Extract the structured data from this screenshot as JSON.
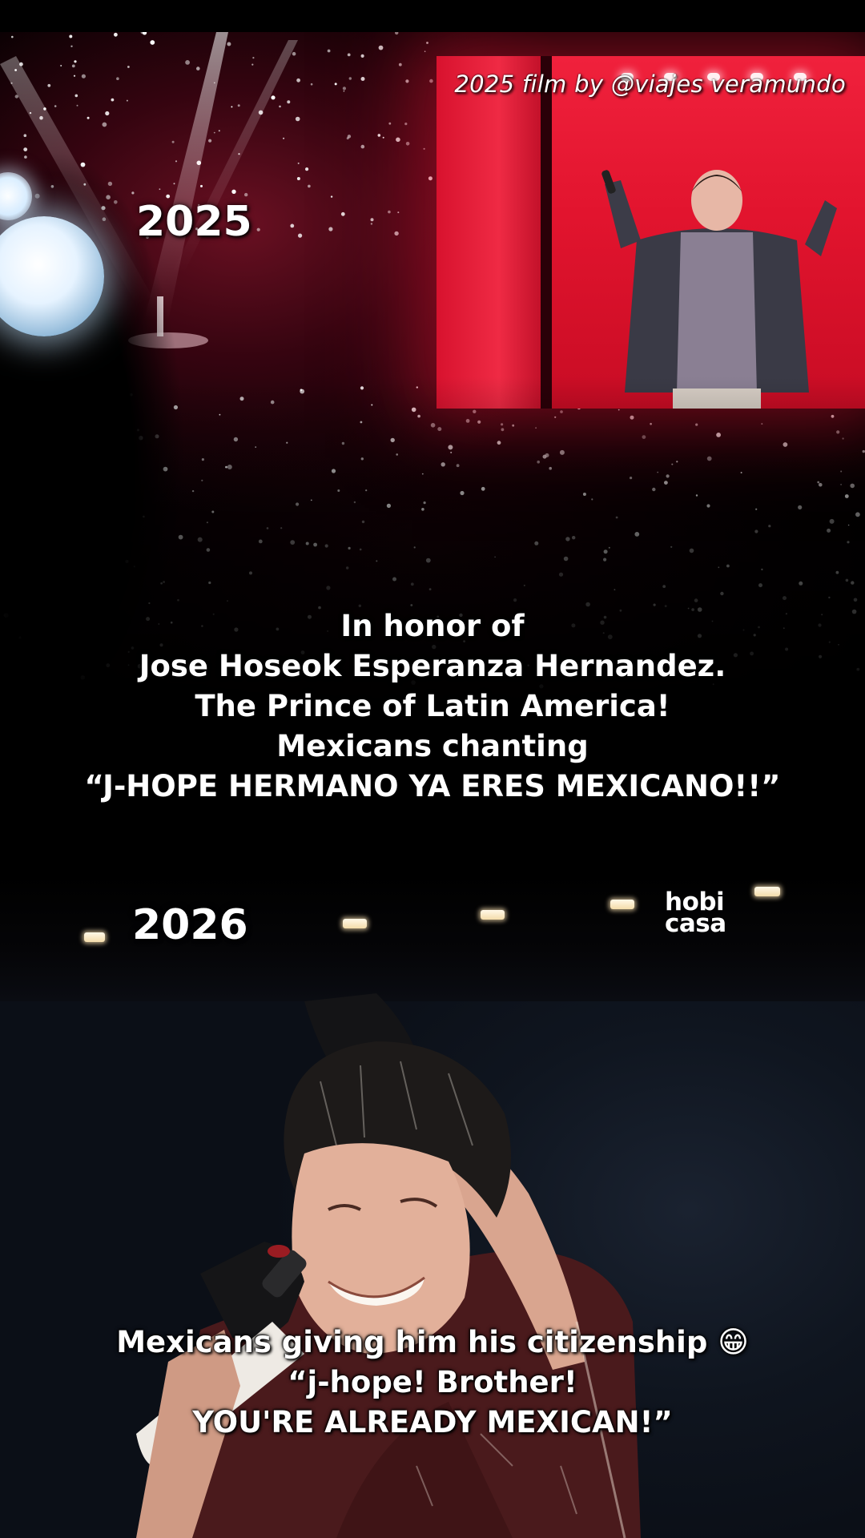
{
  "credit": "2025 film by @viajes veramundo",
  "top_panel": {
    "year": "2025"
  },
  "caption_1": {
    "lines": [
      "In honor of",
      "Jose Hoseok Esperanza Hernandez.",
      "The Prince of Latin America!",
      "Mexicans chanting",
      "“J-HOPE HERMANO YA ERES MEXICANO!!”"
    ]
  },
  "middle_band": {
    "year": "2026",
    "logo": {
      "line1": "hobi",
      "line2": "casa"
    }
  },
  "caption_2": {
    "lines": [
      "Mexicans giving him his citizenship 😁",
      "“j-hope! Brother!",
      "YOU'RE ALREADY MEXICAN!”"
    ]
  },
  "colors": {
    "screen_red": "#e2142e",
    "text": "#ffffff",
    "shirt": "#4a1a1c",
    "background": "#000000"
  },
  "icons": [
    "lightstick-icon",
    "stage-light-icon",
    "microphone-icon"
  ]
}
